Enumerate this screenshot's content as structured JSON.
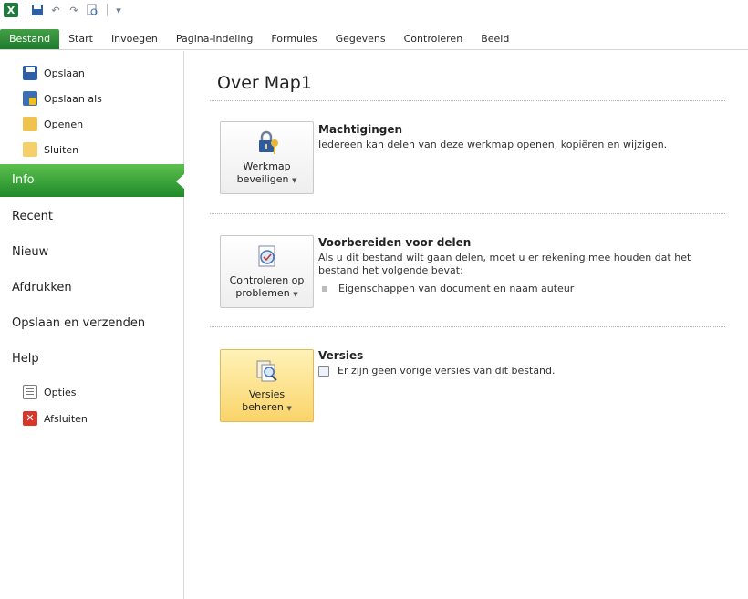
{
  "qat": {
    "icons": [
      "excel-icon",
      "save-icon",
      "undo-icon",
      "redo-icon",
      "print-preview-icon",
      "customize-icon"
    ]
  },
  "ribbon": {
    "tabs": [
      "Bestand",
      "Start",
      "Invoegen",
      "Pagina-indeling",
      "Formules",
      "Gegevens",
      "Controleren",
      "Beeld"
    ],
    "active": "Bestand"
  },
  "left": {
    "small_top": [
      "Opslaan",
      "Opslaan als",
      "Openen",
      "Sluiten"
    ],
    "big": [
      "Info",
      "Recent",
      "Nieuw",
      "Afdrukken",
      "Opslaan en verzenden",
      "Help"
    ],
    "small_bottom": [
      "Opties",
      "Afsluiten"
    ],
    "active": "Info"
  },
  "main": {
    "title": "Over Map1",
    "sections": [
      {
        "button_line1": "Werkmap",
        "button_line2": "beveiligen",
        "heading": "Machtigingen",
        "text": "Iedereen kan delen van deze werkmap openen, kopiëren en wijzigen."
      },
      {
        "button_line1": "Controleren op",
        "button_line2": "problemen",
        "heading": "Voorbereiden voor delen",
        "text": "Als u dit bestand wilt gaan delen, moet u er rekening mee houden dat het bestand het volgende bevat:",
        "bullet": "Eigenschappen van document en naam auteur"
      },
      {
        "button_line1": "Versies",
        "button_line2": "beheren",
        "heading": "Versies",
        "text": "Er zijn geen vorige versies van dit bestand."
      }
    ]
  },
  "colors": {
    "accent_green": "#1f7a2c",
    "highlight_yellow": "#fad46a"
  }
}
